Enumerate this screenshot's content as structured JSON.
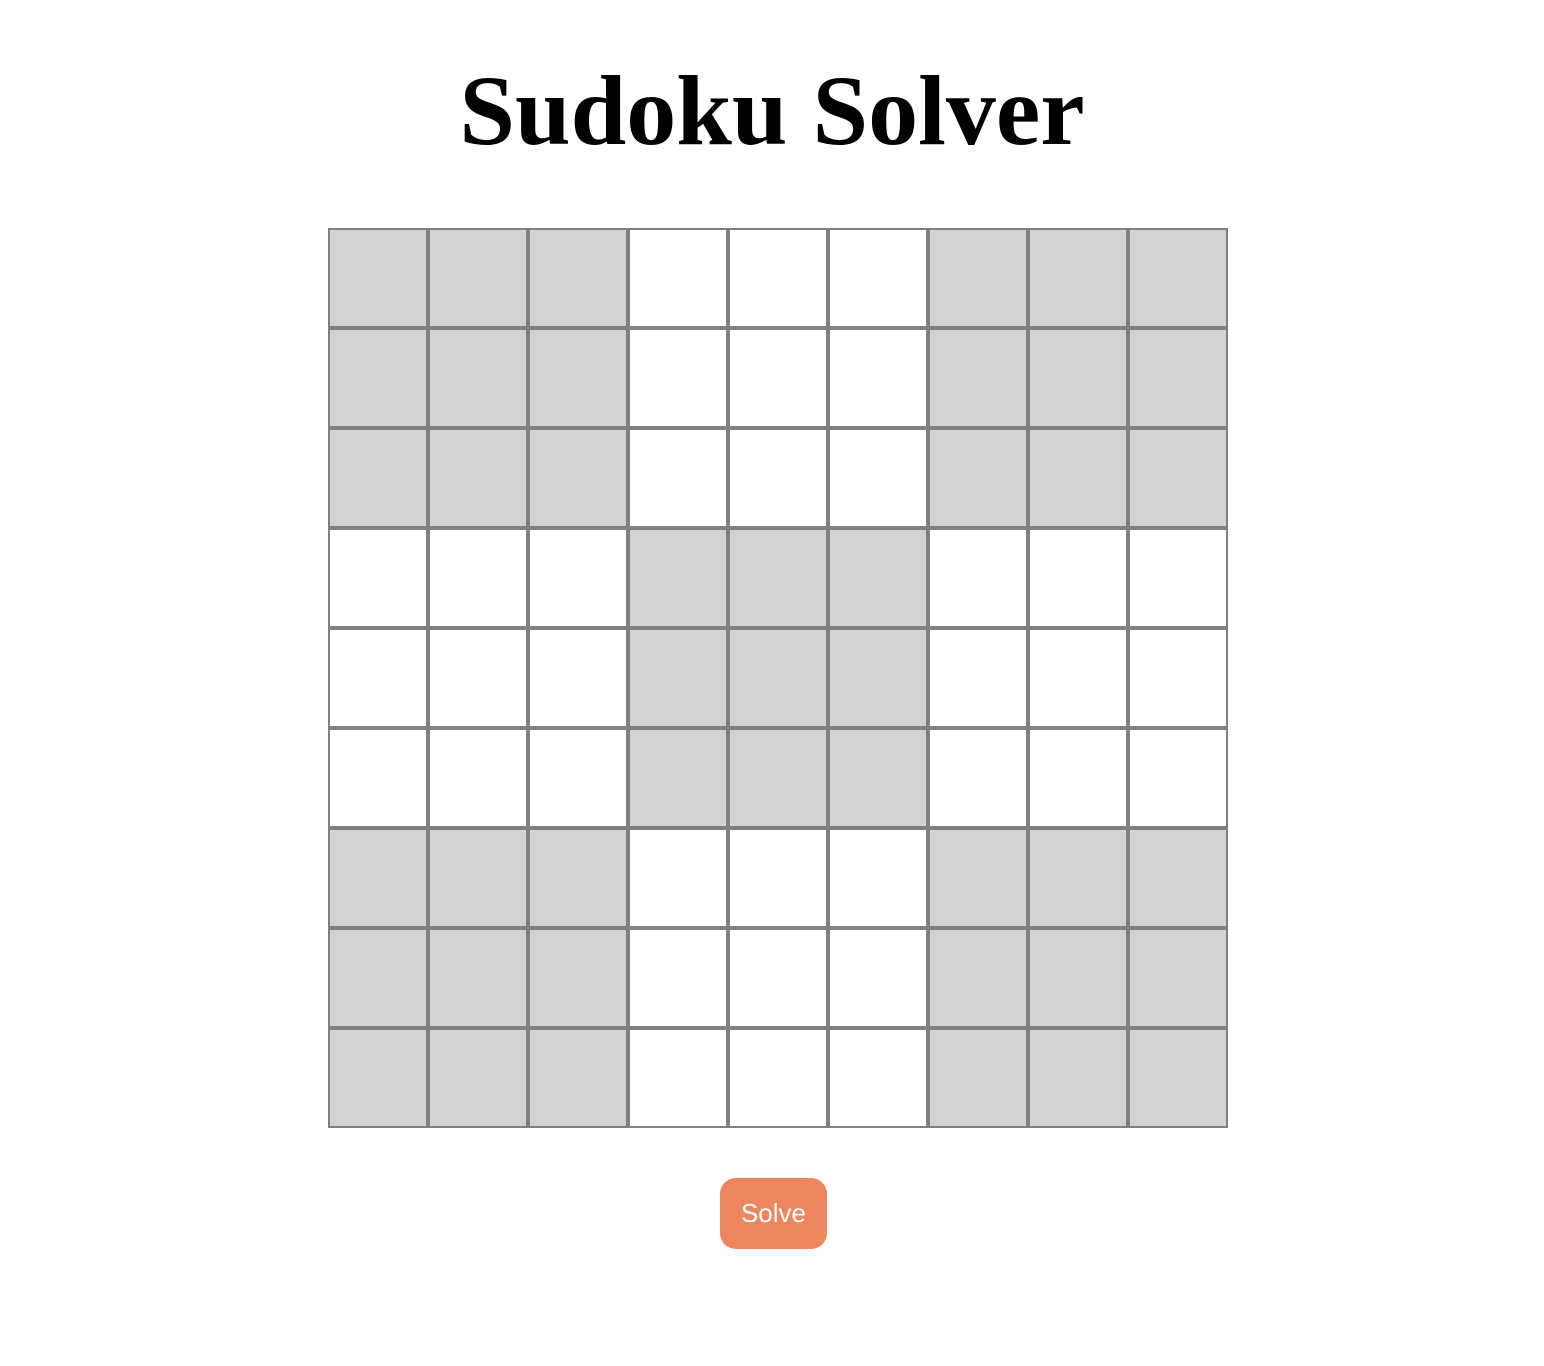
{
  "page": {
    "title": "Sudoku Solver"
  },
  "board": {
    "rows": 9,
    "cols": 9,
    "values": [
      [
        "",
        "",
        "",
        "",
        "",
        "",
        "",
        "",
        ""
      ],
      [
        "",
        "",
        "",
        "",
        "",
        "",
        "",
        "",
        ""
      ],
      [
        "",
        "",
        "",
        "",
        "",
        "",
        "",
        "",
        ""
      ],
      [
        "",
        "",
        "",
        "",
        "",
        "",
        "",
        "",
        ""
      ],
      [
        "",
        "",
        "",
        "",
        "",
        "",
        "",
        "",
        ""
      ],
      [
        "",
        "",
        "",
        "",
        "",
        "",
        "",
        "",
        ""
      ],
      [
        "",
        "",
        "",
        "",
        "",
        "",
        "",
        "",
        ""
      ],
      [
        "",
        "",
        "",
        "",
        "",
        "",
        "",
        "",
        ""
      ],
      [
        "",
        "",
        "",
        "",
        "",
        "",
        "",
        "",
        ""
      ]
    ],
    "shaded_boxes": [
      [
        true,
        false,
        true
      ],
      [
        false,
        true,
        false
      ],
      [
        true,
        false,
        true
      ]
    ],
    "colors": {
      "shaded_cell": "#d3d3d3",
      "plain_cell": "#ffffff",
      "cell_border": "#808080"
    }
  },
  "actions": {
    "solve_label": "Solve",
    "solve_color": "#ee855c"
  }
}
